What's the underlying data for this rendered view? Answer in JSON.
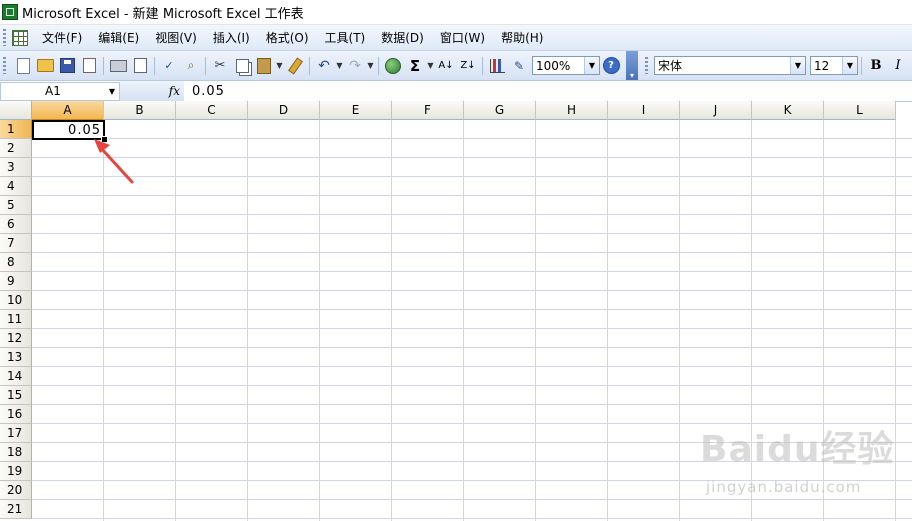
{
  "window": {
    "title": "Microsoft Excel - 新建 Microsoft Excel 工作表",
    "app_icon": "excel-icon"
  },
  "menu": {
    "items": [
      "文件(F)",
      "编辑(E)",
      "视图(V)",
      "插入(I)",
      "格式(O)",
      "工具(T)",
      "数据(D)",
      "窗口(W)",
      "帮助(H)"
    ]
  },
  "toolbar": {
    "zoom": "100%",
    "font_name": "宋体",
    "font_size": "12",
    "bold_label": "B",
    "italic_label": "I",
    "autosum_label": "Σ",
    "sort_asc_label": "A↓",
    "sort_desc_label": "Z↓",
    "help_label": "?"
  },
  "formula_bar": {
    "name_box": "A1",
    "fx_label": "fx",
    "formula": "0.05"
  },
  "sheet": {
    "columns": [
      "A",
      "B",
      "C",
      "D",
      "E",
      "F",
      "G",
      "H",
      "I",
      "J",
      "K",
      "L"
    ],
    "rows": [
      "1",
      "2",
      "3",
      "4",
      "5",
      "6",
      "7",
      "8",
      "9",
      "10",
      "11",
      "12",
      "13",
      "14",
      "15",
      "16",
      "17",
      "18",
      "19",
      "20",
      "21"
    ],
    "active_cell_value": "0.05",
    "active_column": "A",
    "active_row": "1",
    "annotation_color": "#e8453c"
  },
  "watermark": {
    "brand": "Baidu经验",
    "url": "jingyan.baidu.com"
  }
}
